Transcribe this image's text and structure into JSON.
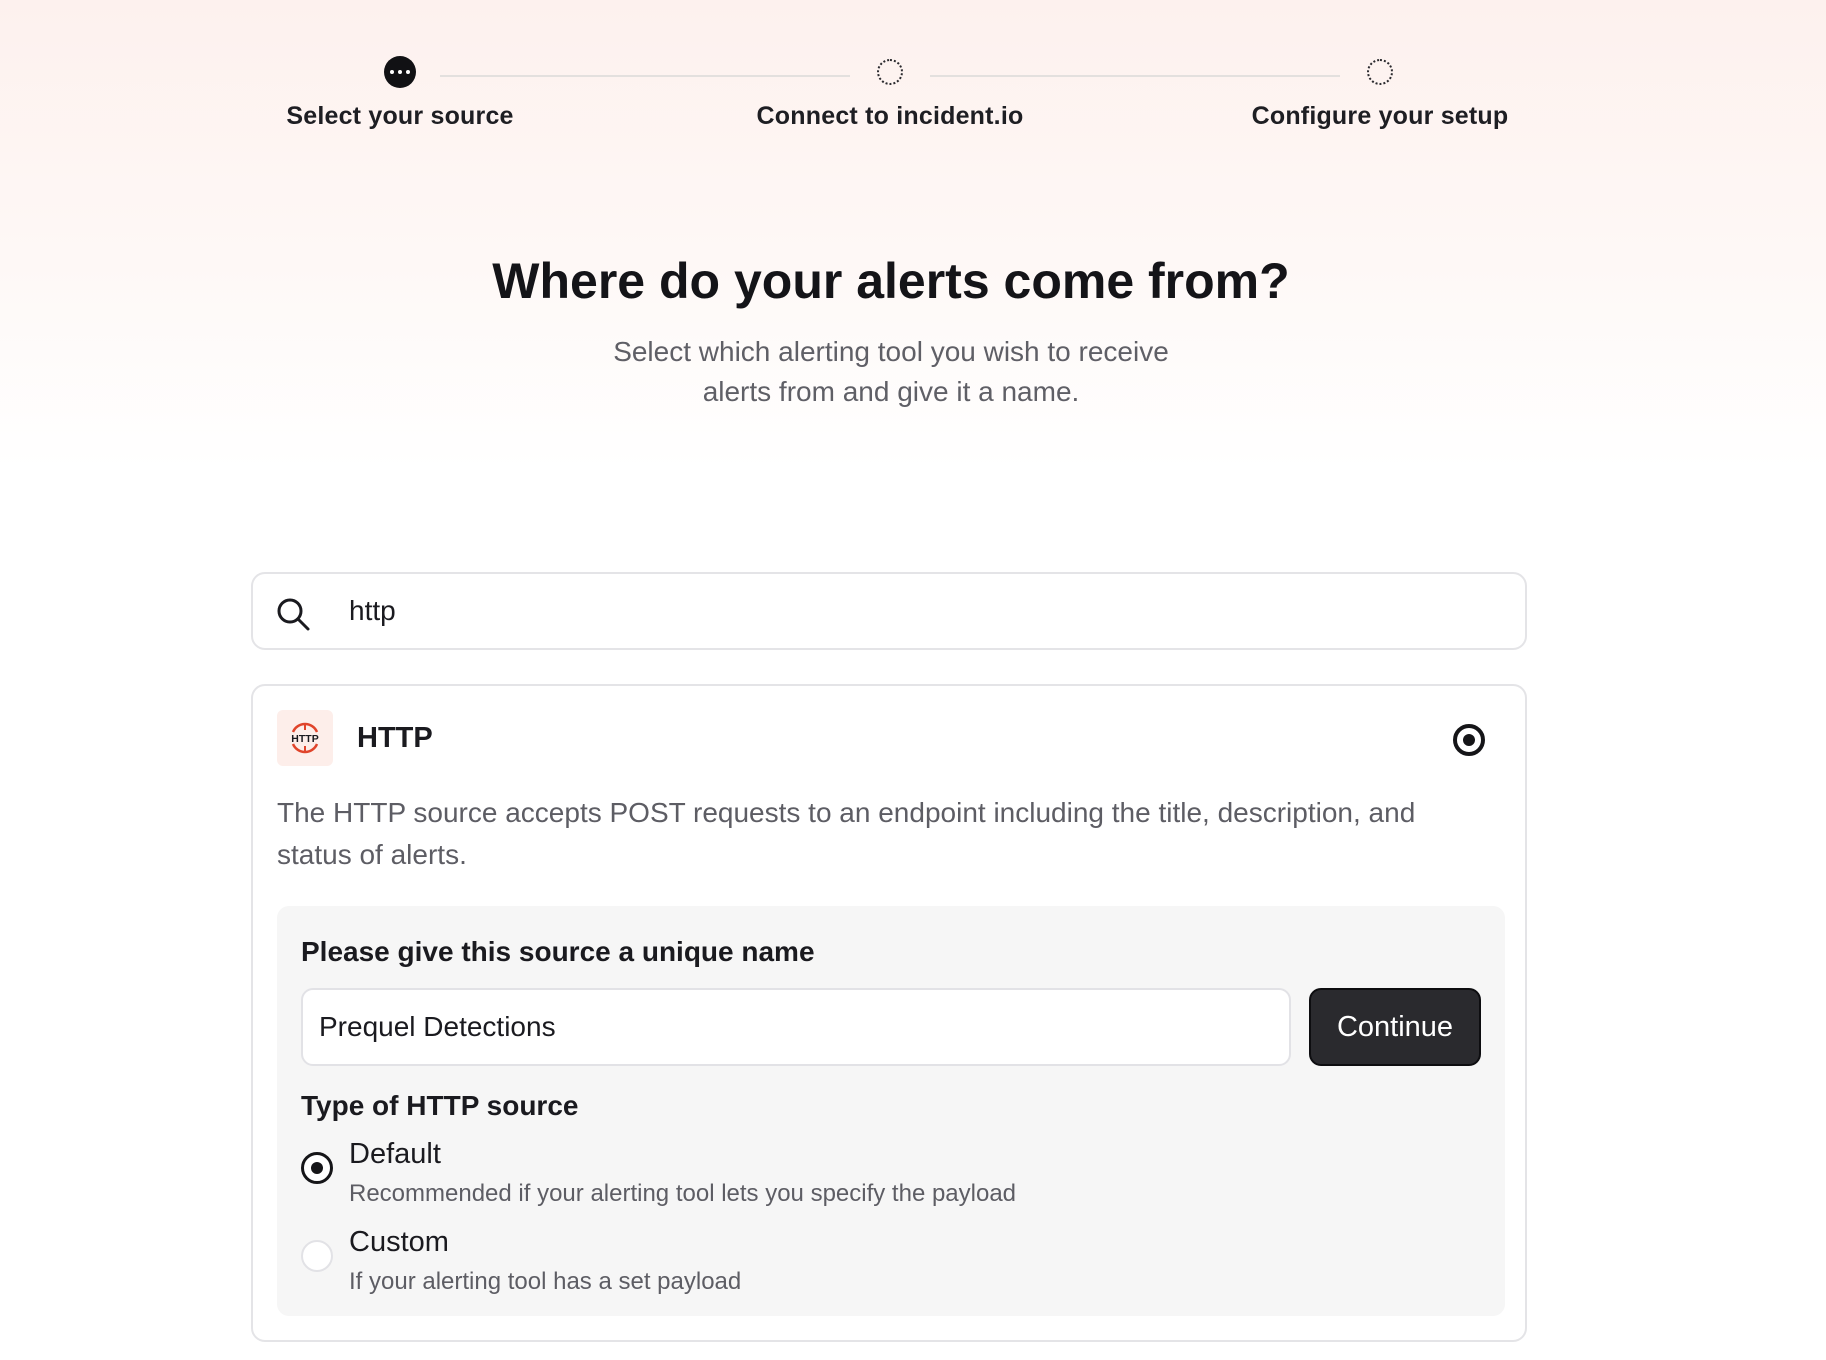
{
  "stepper": {
    "steps": [
      {
        "label": "Select your source",
        "state": "active"
      },
      {
        "label": "Connect to incident.io",
        "state": "pending"
      },
      {
        "label": "Configure your setup",
        "state": "pending"
      }
    ]
  },
  "header": {
    "title": "Where do your alerts come from?",
    "subtitle": "Select which alerting tool you wish to receive alerts from and give it a name."
  },
  "search": {
    "value": "http",
    "icon": "search-icon"
  },
  "source_card": {
    "logo_text": "HTTP",
    "logo_color": "#e0442b",
    "title": "HTTP",
    "selected": true,
    "description": "The HTTP source accepts POST requests to an endpoint including the title, description, and status of alerts.",
    "name_label": "Please give this source a unique name",
    "name_value": "Prequel Detections",
    "continue_label": "Continue",
    "type_label": "Type of HTTP source",
    "options": [
      {
        "title": "Default",
        "subtitle": "Recommended if your alerting tool lets you specify the payload",
        "checked": true
      },
      {
        "title": "Custom",
        "subtitle": "If your alerting tool has a set payload",
        "checked": false
      }
    ]
  },
  "colors": {
    "primary_dark": "#2a2a2e",
    "muted_text": "#5d5d64",
    "border": "#e4e4e7"
  }
}
